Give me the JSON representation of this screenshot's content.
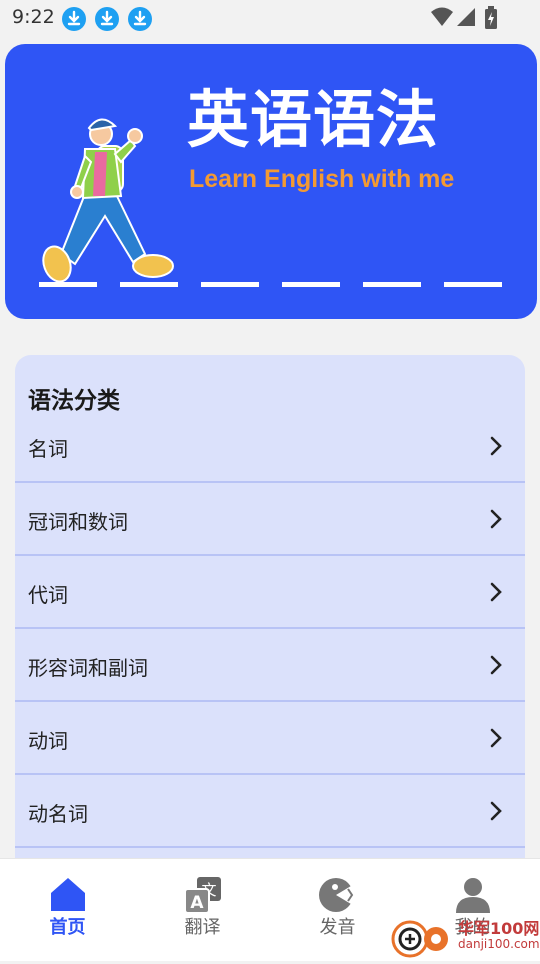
{
  "status_bar": {
    "time": "9:22",
    "download_icons": [
      "download-icon",
      "download-icon",
      "download-icon"
    ],
    "system_icons": [
      "wifi-icon",
      "signal-icon",
      "battery-charging-icon"
    ]
  },
  "banner": {
    "title": "英语语法",
    "subtitle": "Learn English with me",
    "bg_color": "#2f55f5",
    "subtitle_color": "#f39a33"
  },
  "grammar": {
    "title": "语法分类",
    "items": [
      {
        "label": "名词"
      },
      {
        "label": "冠词和数词"
      },
      {
        "label": "代词"
      },
      {
        "label": "形容词和副词"
      },
      {
        "label": "动词"
      },
      {
        "label": "动名词"
      }
    ]
  },
  "tabs": [
    {
      "label": "首页",
      "icon": "home-icon",
      "active": true
    },
    {
      "label": "翻译",
      "icon": "translate-icon",
      "active": false
    },
    {
      "label": "发音",
      "icon": "pronunciation-icon",
      "active": false
    },
    {
      "label": "我的",
      "icon": "profile-icon",
      "active": false
    }
  ],
  "watermark": {
    "text": "华军100网",
    "url": "danji100.com"
  }
}
